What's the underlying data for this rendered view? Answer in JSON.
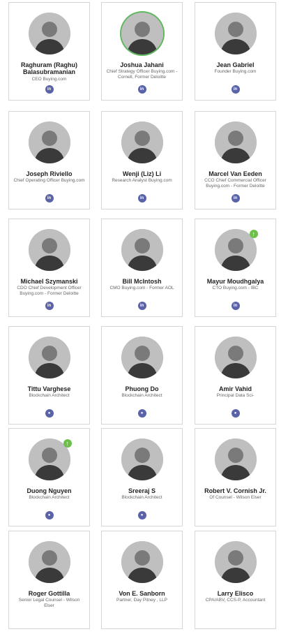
{
  "team": [
    {
      "name": "Raghuram (Raghu) Balasubramanian",
      "role": "CEO Buying.com",
      "social": "linkedin",
      "social_label": "in",
      "badge": false,
      "ring": false
    },
    {
      "name": "Joshua Jahani",
      "role": "Chief Strategy Officer Buying.com - Cornell, Former Deloitte",
      "social": "linkedin",
      "social_label": "in",
      "badge": false,
      "ring": true
    },
    {
      "name": "Jean Gabriel",
      "role": "Founder Buying.com",
      "social": "linkedin",
      "social_label": "in",
      "badge": false,
      "ring": false
    },
    {
      "name": "Joseph Riviello",
      "role": "Chief Operating Officer Buying.com",
      "social": "linkedin",
      "social_label": "in",
      "badge": false,
      "ring": false
    },
    {
      "name": "Wenji (Liz) Li",
      "role": "Research Analyst Buying.com",
      "social": "linkedin",
      "social_label": "in",
      "badge": false,
      "ring": false
    },
    {
      "name": "Marcel Van Eeden",
      "role": "CCO Chief Commercial Officer Buying.com - Former Deloitte",
      "social": "linkedin",
      "social_label": "in",
      "badge": false,
      "ring": false
    },
    {
      "name": "Michael Szymanski",
      "role": "CDO Chief Development Officer Buying.com - Former Deloitte",
      "social": "linkedin",
      "social_label": "in",
      "badge": false,
      "ring": false
    },
    {
      "name": "Bill McIntosh",
      "role": "CMO Buying.com - Former AOL",
      "social": "linkedin",
      "social_label": "in",
      "badge": false,
      "ring": false
    },
    {
      "name": "Mayur Moudhgalya",
      "role": "CTO Buying.com - IBC",
      "social": "linkedin",
      "social_label": "in",
      "badge": true,
      "ring": false
    },
    {
      "name": "Tittu Varghese",
      "role": "Blockchain Architect",
      "social": "github",
      "social_label": "●",
      "badge": false,
      "ring": false
    },
    {
      "name": "Phuong Do",
      "role": "Blockchain Architect",
      "social": "github",
      "social_label": "●",
      "badge": false,
      "ring": false
    },
    {
      "name": "Amir Vahid",
      "role": "Principal Data Sci-",
      "social": "github",
      "social_label": "●",
      "badge": false,
      "ring": false
    },
    {
      "name": "Duong Nguyen",
      "role": "Blockchain Architect",
      "social": "github",
      "social_label": "●",
      "badge": true,
      "ring": false
    },
    {
      "name": "Sreeraj S",
      "role": "Blockchain Architect",
      "social": "github",
      "social_label": "●",
      "badge": false,
      "ring": false
    },
    {
      "name": "Robert V. Cornish Jr.",
      "role": "Of Counsel - Wilson Elser",
      "social": "",
      "social_label": "",
      "badge": false,
      "ring": false
    },
    {
      "name": "Roger Gottilla",
      "role": "Senior Legal Counsel - Wilson Elser",
      "social": "",
      "social_label": "",
      "badge": false,
      "ring": false
    },
    {
      "name": "Von E. Sanborn",
      "role": "Partner, Day Pitney , LLP",
      "social": "",
      "social_label": "",
      "badge": false,
      "ring": false
    },
    {
      "name": "Larry Elisco",
      "role": "CPA/ABV, CCS-P, Accountant",
      "social": "",
      "social_label": "",
      "badge": false,
      "ring": false
    }
  ],
  "badge_icon": "upvote-arrow-icon",
  "colors": {
    "social": "#5a63a8",
    "badge": "#6cc04a",
    "ring": "#5cb85c"
  }
}
